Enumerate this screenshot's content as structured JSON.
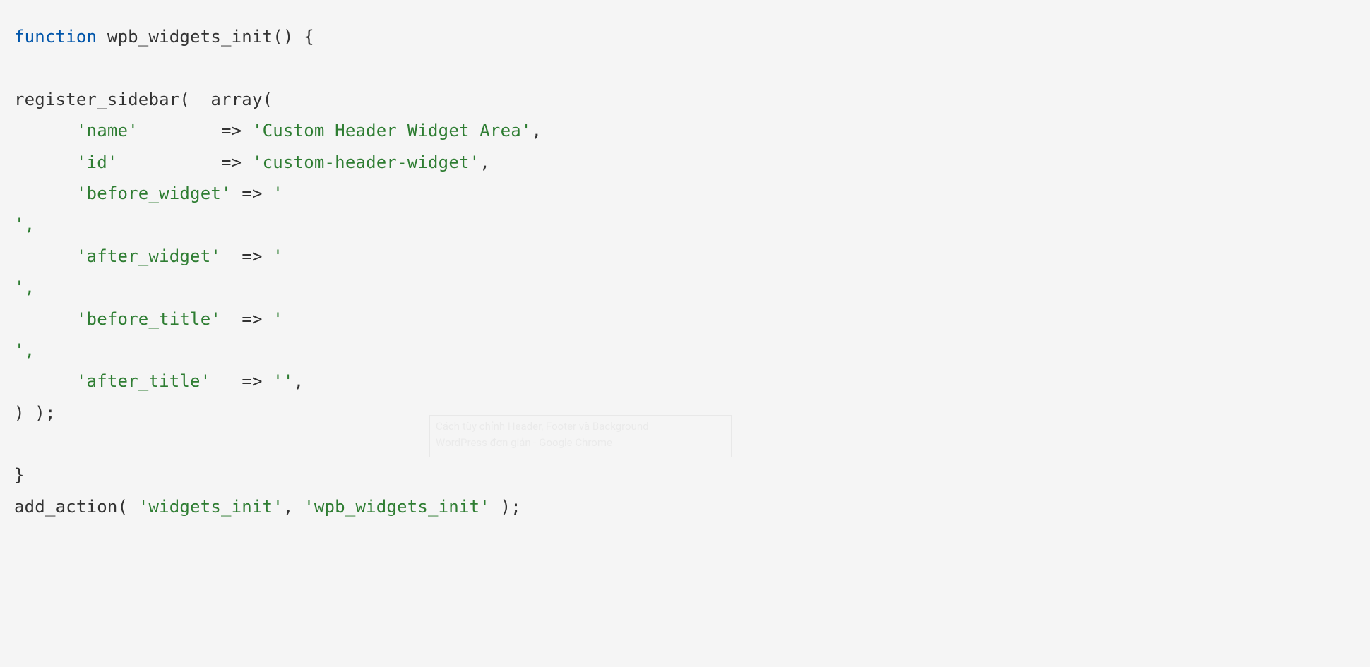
{
  "code": {
    "line1": {
      "kw_function": "function",
      "fn_name": "wpb_widgets_init",
      "parens": "()",
      "open_brace": "{"
    },
    "line2_blank": "",
    "line3": {
      "call": "register_sidebar",
      "open": "(",
      "sp": "  ",
      "array_kw": "array",
      "open2": "("
    },
    "line4": {
      "indent": "      ",
      "key": "'name'",
      "pad": "        ",
      "arrow": "=>",
      "sp": " ",
      "val": "'Custom Header Widget Area'",
      "comma": ","
    },
    "line5": {
      "indent": "      ",
      "key": "'id'",
      "pad": "          ",
      "arrow": "=>",
      "sp": " ",
      "val": "'custom-header-widget'",
      "comma": ","
    },
    "line6": {
      "indent": "      ",
      "key": "'before_widget'",
      "pad": " ",
      "arrow": "=>",
      "sp": " ",
      "val": "'"
    },
    "line7": {
      "frag": "',"
    },
    "line8": {
      "indent": "      ",
      "key": "'after_widget'",
      "pad": "  ",
      "arrow": "=>",
      "sp": " ",
      "val": "'"
    },
    "line9": {
      "frag": "',"
    },
    "line10": {
      "indent": "      ",
      "key": "'before_title'",
      "pad": "  ",
      "arrow": "=>",
      "sp": " ",
      "val": "'"
    },
    "line11": {
      "frag": "',"
    },
    "line12": {
      "indent": "      ",
      "key": "'after_title'",
      "pad": "   ",
      "arrow": "=>",
      "sp": " ",
      "val": "''",
      "comma": ","
    },
    "line13": {
      "close": ") );"
    },
    "line14_blank": "",
    "line15": {
      "close_brace": "}"
    },
    "line16": {
      "fn": "add_action",
      "open": "(",
      "sp1": " ",
      "arg1": "'widgets_init'",
      "comma": ",",
      "sp2": " ",
      "arg2": "'wpb_widgets_init'",
      "sp3": " ",
      "close": ");"
    }
  },
  "ghost_popup": {
    "line1": "Cách tùy chỉnh Header, Footer và Background",
    "line2": "WordPress đơn giản - Google Chrome"
  }
}
